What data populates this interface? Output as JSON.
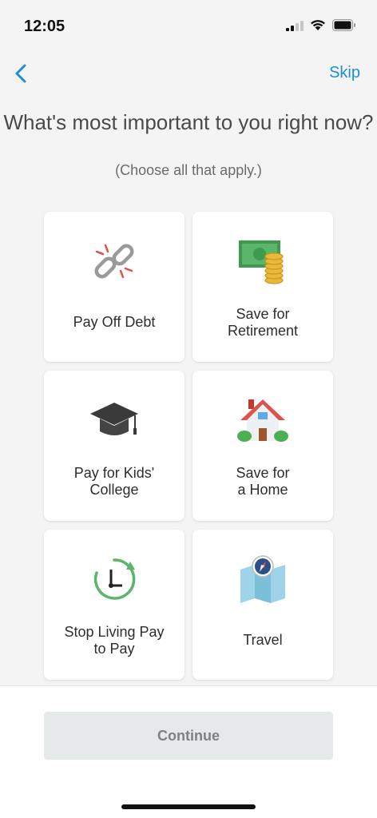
{
  "status": {
    "time": "12:05"
  },
  "nav": {
    "skip_label": "Skip"
  },
  "headline": "What's most important to you right now?",
  "subhead": "(Choose all that apply.)",
  "options": [
    {
      "label": "Pay Off Debt",
      "icon": "broken-chain-icon"
    },
    {
      "label": "Save for\nRetirement",
      "icon": "money-coins-icon"
    },
    {
      "label": "Pay for Kids'\nCollege",
      "icon": "graduation-cap-icon"
    },
    {
      "label": "Save for\na Home",
      "icon": "house-icon"
    },
    {
      "label": "Stop Living Pay\nto Pay",
      "icon": "clock-icon"
    },
    {
      "label": "Travel",
      "icon": "map-compass-icon"
    }
  ],
  "continue_label": "Continue",
  "colors": {
    "accent": "#1b8fd6",
    "background": "#f3f4f3",
    "button_disabled": "#e6e9ea"
  }
}
